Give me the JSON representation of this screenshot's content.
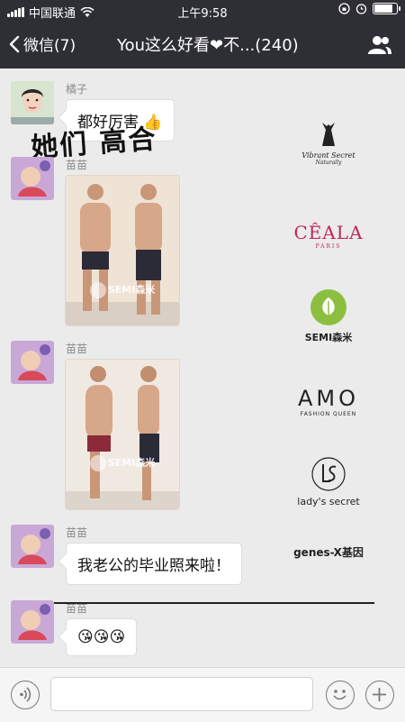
{
  "status_bar": {
    "carrier": "中国联通",
    "time": "上午9:58",
    "battery_level": 0.9
  },
  "nav": {
    "back_label": "微信(7)",
    "title": "You这么好看❤不...(240)"
  },
  "messages": [
    {
      "sender": "橘子",
      "text": "都好厉害",
      "emoji": "👍"
    },
    {
      "sender": "苗苗",
      "photo_watermark": "SEMI森米"
    },
    {
      "sender": "苗苗",
      "photo_watermark": "SEMI森米"
    },
    {
      "sender": "苗苗",
      "text": "我老公的毕业照来啦！"
    },
    {
      "sender": "苗苗",
      "emoji": "😘😘😘"
    }
  ],
  "brands": [
    {
      "name": "Vibrant Secret",
      "sub": "Naturally"
    },
    {
      "name": "CÊALA",
      "sub": "PARIS"
    },
    {
      "name": "SEMI森米"
    },
    {
      "name": "AMO",
      "sub": "FASHION QUEEN"
    },
    {
      "name": "lady's secret"
    },
    {
      "name": "genes-X基因"
    }
  ],
  "overlay_text": "她们 高合",
  "colors": {
    "topbar": "#2e2e35",
    "chat_bg": "#ebebeb",
    "bubble": "#ffffff"
  }
}
